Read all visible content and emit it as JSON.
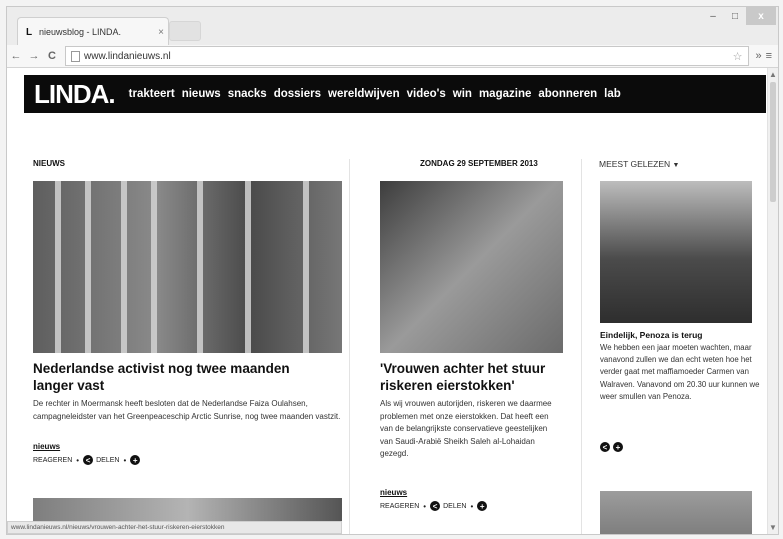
{
  "browser": {
    "tab_title": "nieuwsblog - LINDA.",
    "tab_close": "×",
    "url": "www.lindanieuws.nl",
    "back": "←",
    "forward": "→",
    "reload": "C",
    "minimize": "–",
    "maximize": "□",
    "close": "x"
  },
  "site": {
    "logo": "LINDA.",
    "nav": [
      "trakteert",
      "nieuws",
      "snacks",
      "dossiers",
      "wereldwijven",
      "video's",
      "win",
      "magazine",
      "abonneren",
      "lab"
    ]
  },
  "labels": {
    "section": "NIEUWS",
    "date": "ZONDAG 29 SEPTEMBER 2013",
    "most_read": "MEEST GELEZEN"
  },
  "articles": [
    {
      "headline": "Nederlandse activist nog twee maanden langer vast",
      "body": "De rechter in Moermansk heeft besloten dat de Nederlandse Faiza Oulahsen, campagneleidster van het Greenpeaceschip Arctic Sunrise, nog twee maanden vastzit.",
      "tag": "nieuws",
      "react": "REAGEREN",
      "share": "DELEN"
    },
    {
      "headline": "'Vrouwen achter het stuur riskeren eierstokken'",
      "body": "Als wij vrouwen autorijden, riskeren we daarmee problemen met onze eierstokken. Dat heeft een van de belangrijkste conservatieve geestelijken van Saudi-Arabië Sheikh Saleh al-Lohaidan gezegd.",
      "tag": "nieuws",
      "react": "REAGEREN",
      "share": "DELEN"
    },
    {
      "headline": "Eindelijk, Penoza is terug",
      "body": "We hebben een jaar moeten wachten, maar vanavond zullen we dan echt weten hoe het verder gaat met maffiamoeder Carmen van Walraven. Vanavond om 20.30 uur kunnen we weer smullen van Penoza."
    }
  ],
  "status_url": "www.lindanieuws.nl/nieuws/vrouwen-achter-het-stuur-riskeren-eierstokken"
}
